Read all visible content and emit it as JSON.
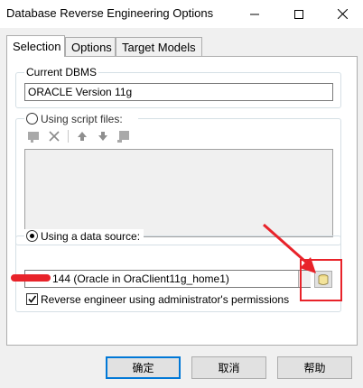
{
  "window": {
    "title": "Database Reverse Engineering Options",
    "controls": {
      "minimize": "—",
      "maximize": "☐",
      "close": "✕"
    }
  },
  "tabs": [
    {
      "label": "Selection",
      "active": true
    },
    {
      "label": "Options",
      "active": false
    },
    {
      "label": "Target Models",
      "active": false
    }
  ],
  "current_dbms": {
    "label": "Current DBMS",
    "value": "ORACLE Version 11g"
  },
  "script_files": {
    "label": "Using script files:",
    "selected": false,
    "toolbar_icons": [
      "add-file-icon",
      "delete-icon",
      "move-up-icon",
      "move-down-icon",
      "browse-icon"
    ]
  },
  "data_source": {
    "label": "Using a data source:",
    "selected": true,
    "value": "144 (Oracle in OraClient11g_home1)",
    "browse_button_icon": "database-connect-icon"
  },
  "admin_permissions": {
    "label": "Reverse engineer using administrator's permissions",
    "checked": true
  },
  "buttons": {
    "ok": "确定",
    "cancel": "取消",
    "help": "帮助"
  },
  "annotation_colors": {
    "redaction": "#e8232a",
    "highlight": "#e8232a"
  }
}
